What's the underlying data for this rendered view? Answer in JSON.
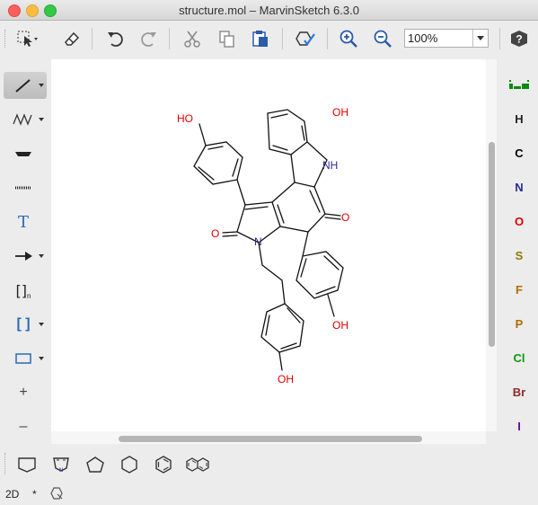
{
  "window": {
    "title": "structure.mol – MarvinSketch 6.3.0"
  },
  "toolbar": {
    "zoom_value": "100%",
    "buttons": [
      "select-icon",
      "eraser-icon",
      "undo-icon",
      "redo-icon",
      "cut-icon",
      "copy-icon",
      "paste-icon",
      "clean-icon",
      "zoom-in-icon",
      "zoom-out-icon",
      "help-icon"
    ]
  },
  "left_tools": [
    {
      "name": "single-bond",
      "dropdown": true
    },
    {
      "name": "chain",
      "dropdown": true
    },
    {
      "name": "wedge-bond",
      "dropdown": false
    },
    {
      "name": "dotted-bond",
      "dropdown": false
    },
    {
      "name": "text",
      "label": "T",
      "dropdown": false
    },
    {
      "name": "reaction-arrow",
      "dropdown": true
    },
    {
      "name": "sgroup-bracket",
      "label": "[]n",
      "dropdown": false
    },
    {
      "name": "bracket",
      "label": "[ ]",
      "dropdown": true
    },
    {
      "name": "rectangle",
      "dropdown": true
    },
    {
      "name": "plus",
      "label": "+",
      "dropdown": false
    },
    {
      "name": "minus",
      "label": "–",
      "dropdown": false
    }
  ],
  "elements": [
    {
      "symbol": "H",
      "color": "#222222"
    },
    {
      "symbol": "C",
      "color": "#000000"
    },
    {
      "symbol": "N",
      "color": "#2a2a9c"
    },
    {
      "symbol": "O",
      "color": "#e00000"
    },
    {
      "symbol": "S",
      "color": "#8a7b00"
    },
    {
      "symbol": "F",
      "color": "#b26b00"
    },
    {
      "symbol": "P",
      "color": "#b26b00"
    },
    {
      "symbol": "Cl",
      "color": "#0a9a0a"
    },
    {
      "symbol": "Br",
      "color": "#8b2a2a"
    },
    {
      "symbol": "I",
      "color": "#6a0a9a"
    }
  ],
  "molecule": {
    "labels": {
      "oh1": "HO",
      "oh2": "OH",
      "nh": "NH",
      "o1": "O",
      "o2": "O",
      "n": "N",
      "oh3": "OH",
      "oh4": "OH"
    }
  },
  "status": {
    "mode": "2D",
    "star": "*"
  }
}
